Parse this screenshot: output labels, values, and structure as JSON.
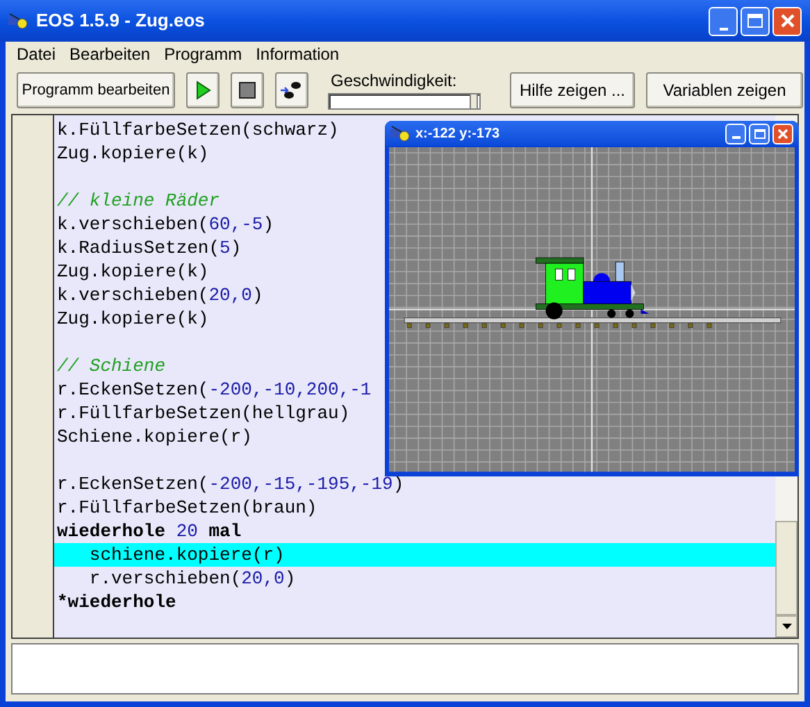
{
  "window": {
    "title": "EOS 1.5.9 - Zug.eos"
  },
  "menu": [
    "Datei",
    "Bearbeiten",
    "Programm",
    "Information"
  ],
  "toolbar": {
    "edit_button": "Programm bearbeiten",
    "speed_label": "Geschwindigkeit:",
    "speed": {
      "level": 0.97
    },
    "help_button": "Hilfe zeigen ...",
    "variables_button": "Variablen zeigen"
  },
  "code_lines": [
    {
      "selected": false,
      "tokens": [
        {
          "kind": "plain",
          "text": "k.FüllfarbeSetzen(schwarz)"
        }
      ]
    },
    {
      "selected": false,
      "tokens": [
        {
          "kind": "plain",
          "text": "Zug.kopiere(k)"
        }
      ]
    },
    {
      "selected": false
    },
    {
      "selected": false,
      "tokens": [
        {
          "kind": "comment",
          "text": "// kleine Räder"
        }
      ]
    },
    {
      "selected": false,
      "tokens": [
        {
          "kind": "plain",
          "text": "k.verschieben("
        },
        {
          "kind": "number",
          "text": "60,-5"
        },
        {
          "kind": "plain",
          "text": ")"
        }
      ]
    },
    {
      "selected": false,
      "tokens": [
        {
          "kind": "plain",
          "text": "k.RadiusSetzen("
        },
        {
          "kind": "number",
          "text": "5"
        },
        {
          "kind": "plain",
          "text": ")"
        }
      ]
    },
    {
      "selected": false,
      "tokens": [
        {
          "kind": "plain",
          "text": "Zug.kopiere(k)"
        }
      ]
    },
    {
      "selected": false,
      "tokens": [
        {
          "kind": "plain",
          "text": "k.verschieben("
        },
        {
          "kind": "number",
          "text": "20,0"
        },
        {
          "kind": "plain",
          "text": ")"
        }
      ]
    },
    {
      "selected": false,
      "tokens": [
        {
          "kind": "plain",
          "text": "Zug.kopiere(k)"
        }
      ]
    },
    {
      "selected": false
    },
    {
      "selected": false,
      "tokens": [
        {
          "kind": "comment",
          "text": "// Schiene"
        }
      ]
    },
    {
      "selected": false,
      "tokens": [
        {
          "kind": "plain",
          "text": "r.EckenSetzen("
        },
        {
          "kind": "number",
          "text": "-200,-10,200,-1"
        }
      ]
    },
    {
      "selected": false,
      "tokens": [
        {
          "kind": "plain",
          "text": "r.FüllfarbeSetzen(hellgrau)"
        }
      ]
    },
    {
      "selected": false,
      "tokens": [
        {
          "kind": "plain",
          "text": "Schiene.kopiere(r)"
        }
      ]
    },
    {
      "selected": false
    },
    {
      "selected": false,
      "tokens": [
        {
          "kind": "plain",
          "text": "r.EckenSetzen("
        },
        {
          "kind": "number",
          "text": "-200,-15,-195,-19"
        },
        {
          "kind": "plain",
          "text": ")"
        }
      ]
    },
    {
      "selected": false,
      "tokens": [
        {
          "kind": "plain",
          "text": "r.FüllfarbeSetzen(braun)"
        }
      ]
    },
    {
      "selected": false,
      "tokens": [
        {
          "kind": "keyword",
          "text": "wiederhole "
        },
        {
          "kind": "number",
          "text": "20"
        },
        {
          "kind": "keyword",
          "text": " mal"
        }
      ]
    },
    {
      "selected": true,
      "tokens": [
        {
          "kind": "plain",
          "text": "   schiene.kopiere(r)"
        }
      ]
    },
    {
      "selected": false,
      "tokens": [
        {
          "kind": "plain",
          "text": "   r.verschieben("
        },
        {
          "kind": "number",
          "text": "20,0"
        },
        {
          "kind": "plain",
          "text": ")"
        }
      ]
    },
    {
      "selected": false,
      "tokens": [
        {
          "kind": "keyword",
          "text": "*wiederhole"
        }
      ]
    }
  ],
  "canvas_window": {
    "title": "x:-122 y:-173"
  }
}
